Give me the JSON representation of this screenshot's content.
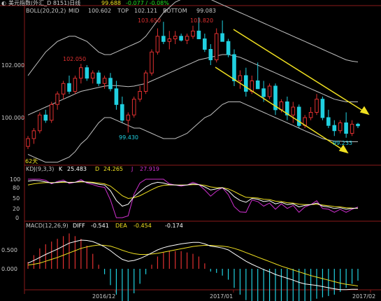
{
  "header": {
    "title": "美元指数(外汇_D 8151)日线",
    "price": "99.688",
    "change": "-0.077 / -0.08%"
  },
  "boll": {
    "label": "BOLL(20,20,2)",
    "mid_label": "MID",
    "mid": "100.602",
    "top_label": "TOP",
    "top": "102.121",
    "bottom_label": "BOTTOM",
    "bottom": "99.083"
  },
  "kdj": {
    "label": "KDJ(9,3,3)",
    "k_label": "K",
    "k": "25.483",
    "d_label": "D",
    "d": "24.265",
    "j_label": "J",
    "j": "27.919"
  },
  "macd": {
    "label": "MACD(12,26,9)",
    "diff_label": "DIFF",
    "diff": "-0.541",
    "dea_label": "DEA",
    "dea": "-0.454",
    "macd_value": "-0.174"
  },
  "annotations": {
    "high1": "102.050",
    "low1": "99.430",
    "high2": "103.650",
    "high3": "103.820",
    "low2": "99.233",
    "days": "62天"
  },
  "colors": {
    "up": "#e03030",
    "down": "#20d0e0",
    "trend": "#f0e020",
    "kdj_k": "#ffffff",
    "kdj_d": "#f0e020",
    "kdj_j": "#d030d0"
  },
  "chart_data": {
    "type": "candlestick",
    "price_ticks": [
      "102.000",
      "100.000"
    ],
    "kdj_ticks": [
      "100",
      "80",
      "50",
      "20",
      "0"
    ],
    "macd_ticks": [
      "0.500",
      "0.000"
    ],
    "x_ticks": [
      "2016/12",
      "2017/01",
      "2017/02"
    ],
    "candles": [
      [
        98.9,
        99.3,
        98.8,
        99.2
      ],
      [
        99.2,
        99.6,
        99.0,
        99.5
      ],
      [
        99.5,
        100.2,
        99.4,
        100.1
      ],
      [
        100.1,
        100.3,
        99.8,
        99.9
      ],
      [
        99.9,
        100.6,
        99.8,
        100.5
      ],
      [
        100.5,
        101.0,
        100.3,
        100.9
      ],
      [
        100.9,
        101.4,
        100.7,
        101.3
      ],
      [
        101.3,
        101.6,
        100.9,
        101.0
      ],
      [
        101.0,
        101.6,
        100.9,
        101.5
      ],
      [
        101.5,
        102.05,
        101.3,
        101.9
      ],
      [
        101.9,
        102.0,
        101.4,
        101.5
      ],
      [
        101.5,
        101.8,
        101.3,
        101.7
      ],
      [
        101.7,
        101.8,
        101.2,
        101.3
      ],
      [
        101.3,
        101.6,
        101.1,
        101.5
      ],
      [
        101.5,
        101.7,
        101.0,
        101.1
      ],
      [
        101.1,
        101.4,
        100.3,
        100.5
      ],
      [
        100.5,
        100.8,
        99.8,
        99.9
      ],
      [
        99.9,
        100.2,
        99.43,
        100.1
      ],
      [
        100.1,
        100.8,
        100.0,
        100.7
      ],
      [
        100.7,
        101.2,
        100.6,
        101.0
      ],
      [
        101.0,
        101.8,
        100.9,
        101.7
      ],
      [
        101.7,
        102.6,
        101.6,
        102.5
      ],
      [
        102.5,
        103.4,
        102.4,
        103.1
      ],
      [
        103.1,
        103.65,
        102.8,
        102.9
      ],
      [
        102.9,
        103.3,
        102.6,
        103.0
      ],
      [
        103.0,
        103.3,
        102.8,
        103.1
      ],
      [
        103.1,
        103.2,
        102.9,
        102.95
      ],
      [
        102.95,
        103.2,
        102.8,
        103.1
      ],
      [
        103.1,
        103.5,
        103.0,
        103.3
      ],
      [
        103.3,
        103.82,
        103.1,
        103.0
      ],
      [
        103.0,
        103.2,
        102.5,
        102.6
      ],
      [
        102.6,
        102.8,
        102.0,
        102.2
      ],
      [
        102.2,
        103.4,
        102.1,
        103.2
      ],
      [
        103.2,
        103.7,
        102.9,
        102.9
      ],
      [
        102.9,
        103.0,
        102.3,
        102.4
      ],
      [
        102.4,
        102.6,
        101.2,
        101.4
      ],
      [
        101.4,
        101.8,
        101.1,
        101.6
      ],
      [
        101.6,
        101.9,
        100.8,
        101.0
      ],
      [
        101.0,
        101.6,
        100.9,
        101.4
      ],
      [
        101.4,
        102.1,
        101.3,
        101.1
      ],
      [
        101.1,
        101.4,
        100.6,
        100.8
      ],
      [
        100.8,
        101.3,
        100.7,
        101.2
      ],
      [
        101.2,
        101.3,
        100.1,
        100.3
      ],
      [
        100.3,
        100.7,
        100.2,
        100.6
      ],
      [
        100.6,
        100.8,
        99.9,
        100.1
      ],
      [
        100.1,
        100.6,
        99.8,
        100.4
      ],
      [
        100.4,
        100.5,
        99.6,
        99.7
      ],
      [
        99.7,
        100.1,
        99.6,
        100.0
      ],
      [
        100.0,
        100.4,
        99.9,
        100.2
      ],
      [
        100.2,
        100.9,
        100.1,
        100.7
      ],
      [
        100.7,
        100.8,
        99.9,
        100.0
      ],
      [
        100.0,
        100.3,
        99.6,
        99.7
      ],
      [
        99.7,
        99.9,
        99.3,
        99.5
      ],
      [
        99.5,
        99.9,
        99.4,
        99.8
      ],
      [
        99.8,
        100.2,
        99.233,
        99.4
      ],
      [
        99.4,
        99.9,
        99.3,
        99.75
      ],
      [
        99.75,
        99.8,
        99.6,
        99.69
      ]
    ],
    "boll_mid": [
      100.1,
      100.2,
      100.3,
      100.4,
      100.5,
      100.6,
      100.7,
      100.8,
      100.9,
      101.0,
      101.05,
      101.1,
      101.15,
      101.2,
      101.22,
      101.22,
      101.2,
      101.18,
      101.2,
      101.25,
      101.3,
      101.4,
      101.5,
      101.6,
      101.7,
      101.8,
      101.9,
      102.0,
      102.1,
      102.2,
      102.25,
      102.3,
      102.35,
      102.4,
      102.4,
      102.35,
      102.3,
      102.2,
      102.1,
      102.0,
      101.9,
      101.8,
      101.7,
      101.6,
      101.5,
      101.4,
      101.3,
      101.2,
      101.1,
      101.0,
      100.9,
      100.8,
      100.7,
      100.65,
      100.6,
      100.6,
      100.6
    ],
    "boll_top": [
      101.6,
      101.9,
      102.2,
      102.5,
      102.7,
      102.9,
      103.0,
      103.1,
      103.1,
      103.0,
      102.9,
      102.7,
      102.5,
      102.4,
      102.4,
      102.5,
      102.6,
      102.7,
      102.8,
      102.9,
      103.1,
      103.4,
      103.7,
      104.0,
      104.2,
      104.4,
      104.5,
      104.6,
      104.6,
      104.6,
      104.5,
      104.5,
      104.4,
      104.3,
      104.2,
      104.1,
      104.0,
      103.9,
      103.8,
      103.7,
      103.6,
      103.5,
      103.4,
      103.3,
      103.2,
      103.1,
      103.0,
      102.9,
      102.8,
      102.7,
      102.6,
      102.5,
      102.4,
      102.3,
      102.2,
      102.15,
      102.12
    ],
    "boll_bottom": [
      98.6,
      98.5,
      98.4,
      98.3,
      98.3,
      98.3,
      98.4,
      98.5,
      98.7,
      99.0,
      99.2,
      99.5,
      99.8,
      100.0,
      100.0,
      99.9,
      99.8,
      99.7,
      99.6,
      99.6,
      99.5,
      99.4,
      99.3,
      99.2,
      99.2,
      99.2,
      99.3,
      99.4,
      99.6,
      99.8,
      100.0,
      100.1,
      100.3,
      100.5,
      100.6,
      100.6,
      100.6,
      100.5,
      100.4,
      100.3,
      100.2,
      100.1,
      100.0,
      99.9,
      99.8,
      99.7,
      99.6,
      99.5,
      99.4,
      99.3,
      99.2,
      99.15,
      99.1,
      99.1,
      99.08,
      99.08,
      99.083
    ],
    "kdj_k": [
      95,
      97,
      96,
      93,
      90,
      92,
      94,
      91,
      92,
      95,
      92,
      90,
      87,
      85,
      70,
      45,
      30,
      35,
      55,
      68,
      80,
      88,
      92,
      90,
      86,
      85,
      84,
      85,
      88,
      86,
      80,
      72,
      75,
      78,
      70,
      55,
      45,
      40,
      50,
      48,
      42,
      44,
      36,
      40,
      34,
      36,
      28,
      32,
      34,
      38,
      30,
      28,
      24,
      26,
      22,
      24,
      25
    ],
    "kdj_d": [
      85,
      88,
      90,
      91,
      91,
      91,
      92,
      92,
      92,
      93,
      93,
      92,
      90,
      88,
      82,
      70,
      57,
      50,
      52,
      57,
      65,
      73,
      80,
      84,
      85,
      85,
      85,
      85,
      86,
      86,
      84,
      80,
      78,
      78,
      75,
      68,
      60,
      53,
      52,
      51,
      48,
      47,
      43,
      42,
      39,
      38,
      35,
      34,
      34,
      35,
      33,
      31,
      29,
      28,
      26,
      25,
      24.3
    ],
    "kdj_j": [
      100,
      100,
      100,
      97,
      88,
      94,
      98,
      89,
      92,
      99,
      90,
      86,
      81,
      79,
      46,
      0,
      0,
      5,
      61,
      90,
      100,
      100,
      100,
      100,
      88,
      85,
      82,
      85,
      92,
      86,
      72,
      56,
      69,
      78,
      60,
      29,
      15,
      14,
      46,
      42,
      30,
      38,
      22,
      36,
      24,
      32,
      14,
      28,
      34,
      44,
      24,
      22,
      14,
      22,
      14,
      22,
      27.9
    ],
    "macd_diff": [
      0.15,
      0.22,
      0.3,
      0.38,
      0.45,
      0.52,
      0.6,
      0.68,
      0.72,
      0.76,
      0.75,
      0.72,
      0.66,
      0.58,
      0.48,
      0.36,
      0.25,
      0.2,
      0.22,
      0.27,
      0.34,
      0.42,
      0.5,
      0.56,
      0.6,
      0.63,
      0.66,
      0.68,
      0.7,
      0.7,
      0.66,
      0.6,
      0.58,
      0.55,
      0.5,
      0.4,
      0.3,
      0.2,
      0.12,
      0.05,
      -0.02,
      -0.08,
      -0.15,
      -0.2,
      -0.25,
      -0.3,
      -0.36,
      -0.4,
      -0.42,
      -0.44,
      -0.47,
      -0.5,
      -0.53,
      -0.55,
      -0.55,
      -0.54,
      -0.541
    ],
    "macd_dea": [
      0.1,
      0.12,
      0.15,
      0.2,
      0.25,
      0.3,
      0.36,
      0.42,
      0.48,
      0.54,
      0.58,
      0.61,
      0.63,
      0.62,
      0.6,
      0.55,
      0.49,
      0.44,
      0.4,
      0.38,
      0.38,
      0.39,
      0.41,
      0.44,
      0.47,
      0.5,
      0.53,
      0.56,
      0.59,
      0.61,
      0.62,
      0.62,
      0.61,
      0.6,
      0.58,
      0.54,
      0.49,
      0.43,
      0.37,
      0.31,
      0.25,
      0.19,
      0.13,
      0.07,
      0.02,
      -0.03,
      -0.08,
      -0.13,
      -0.18,
      -0.22,
      -0.26,
      -0.3,
      -0.34,
      -0.38,
      -0.41,
      -0.43,
      -0.454
    ]
  }
}
